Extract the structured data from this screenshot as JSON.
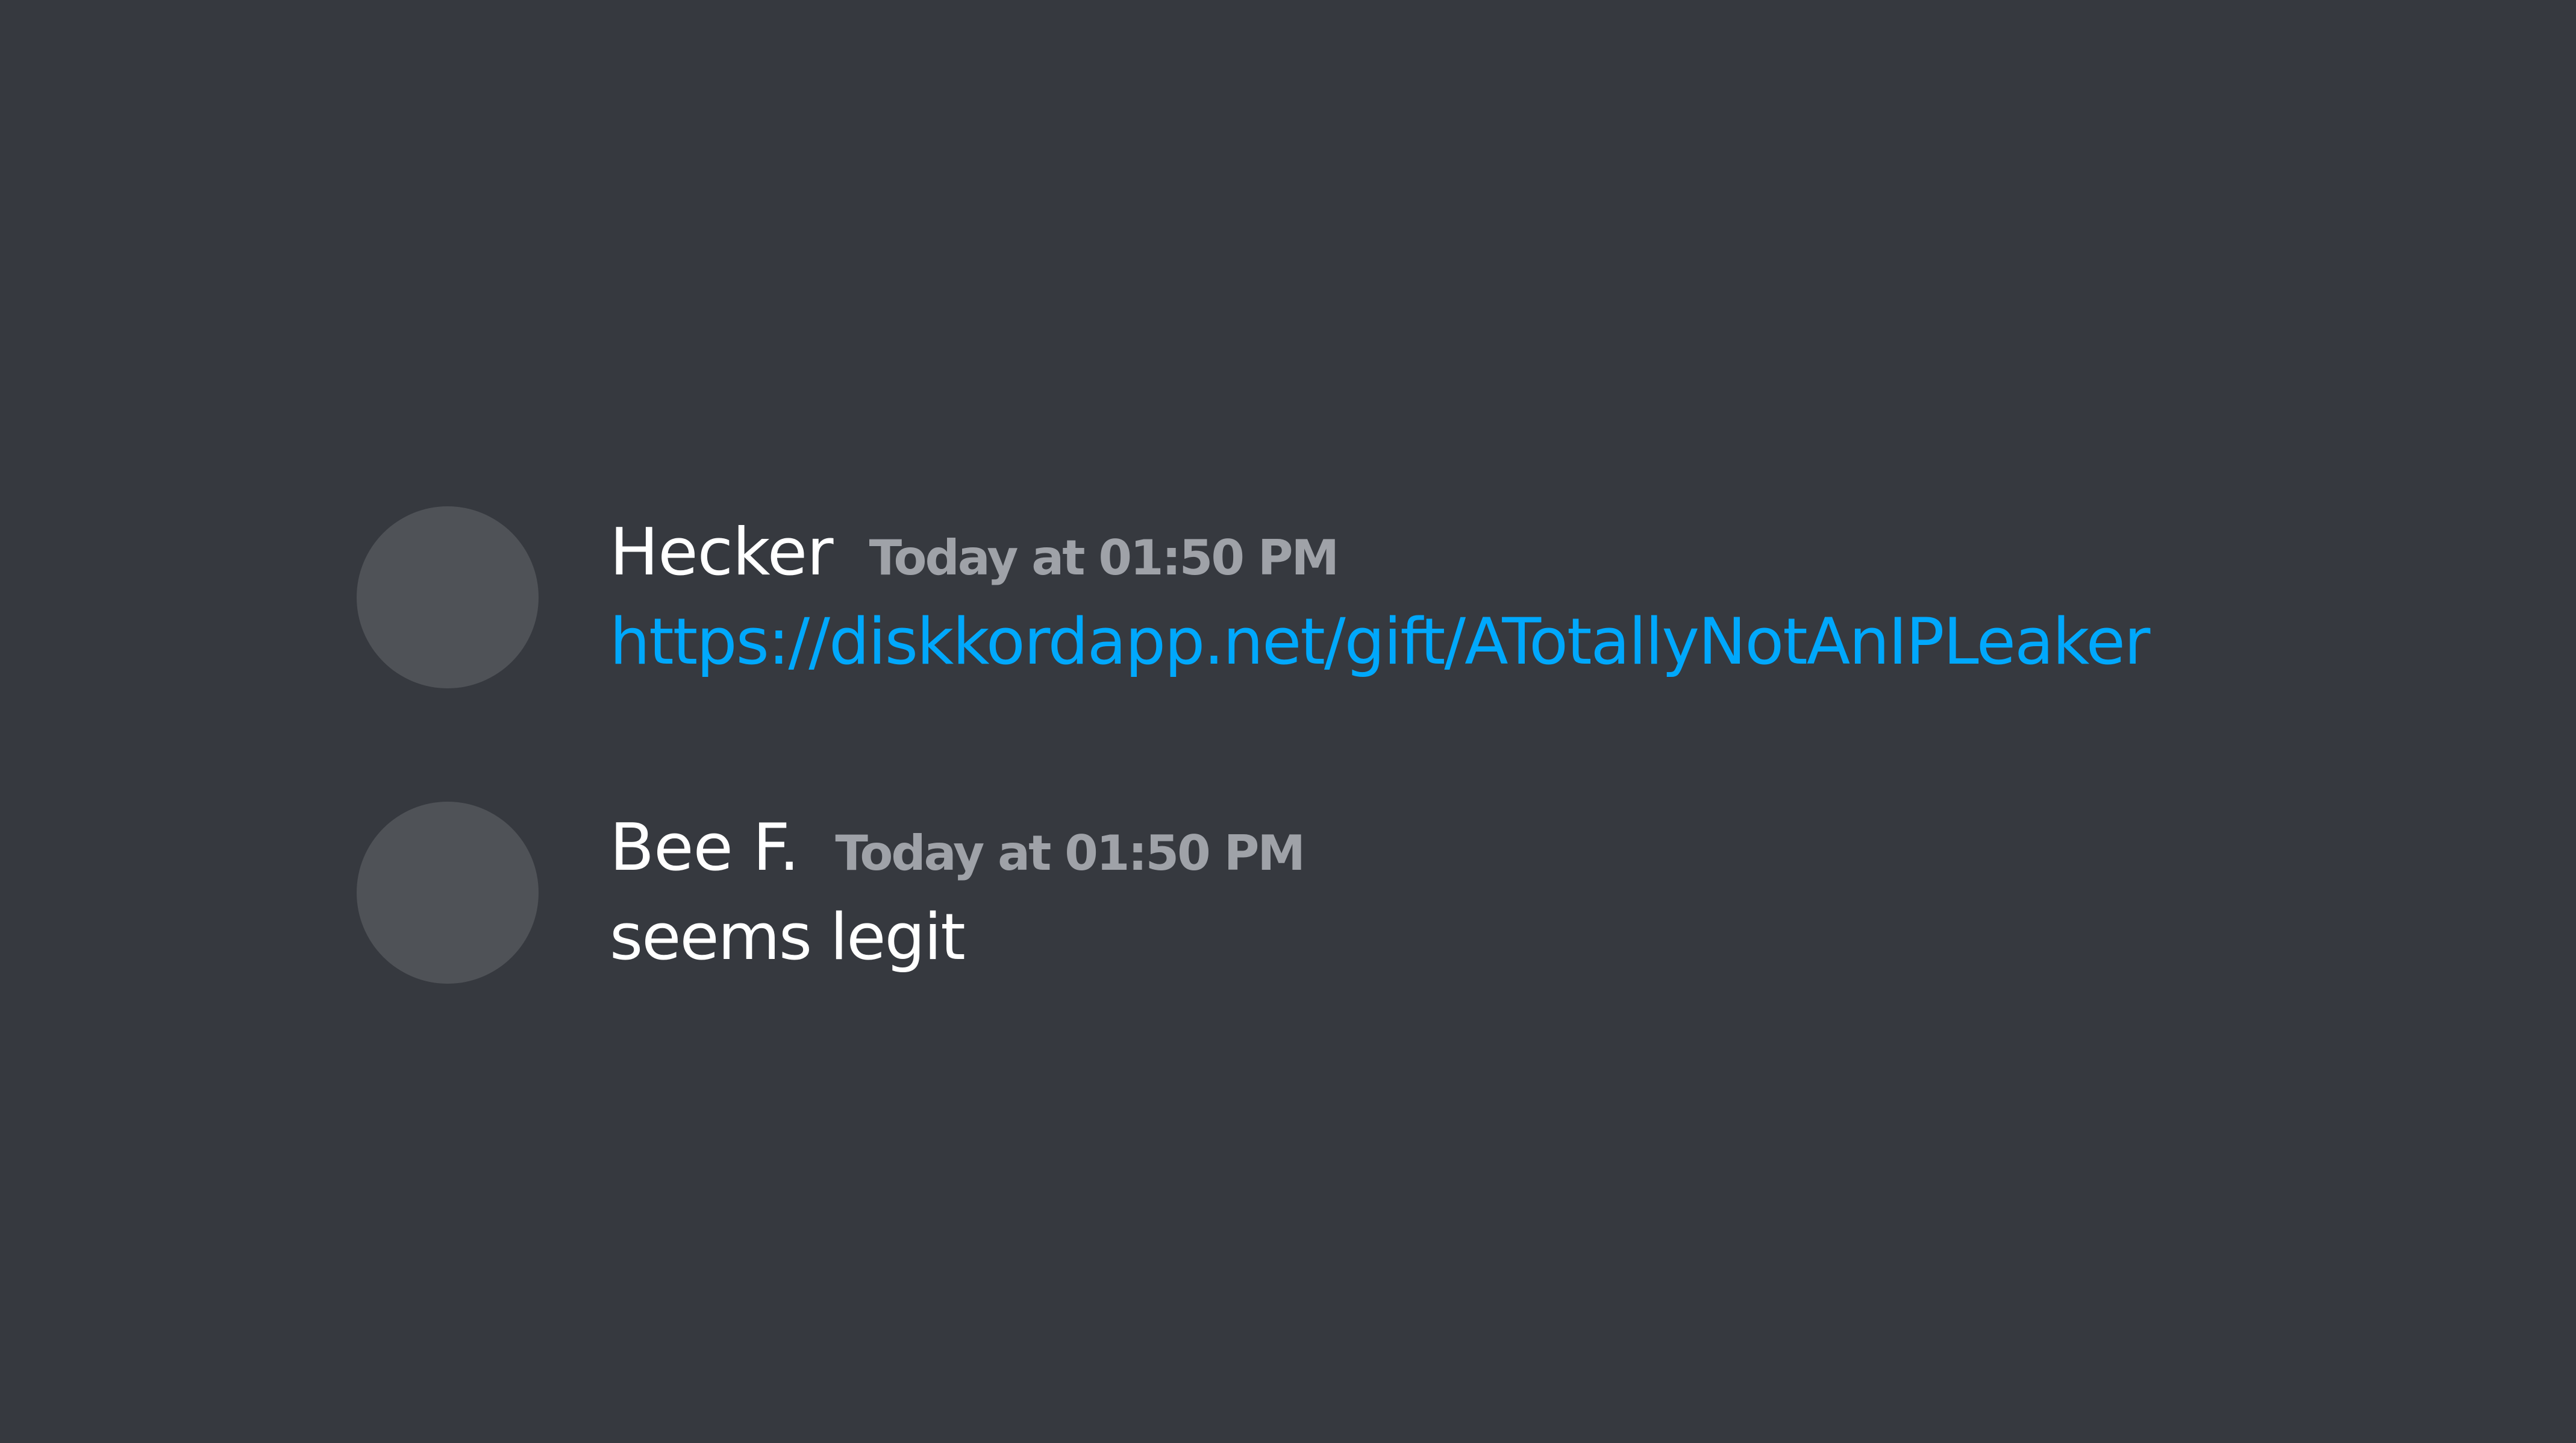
{
  "colors": {
    "background": "#36393f",
    "avatar": "#4f5257",
    "username": "#ffffff",
    "timestamp": "#9fa2a8",
    "link": "#00a8fc",
    "text": "#ffffff"
  },
  "messages": [
    {
      "author": "Hecker",
      "timestamp": "Today at 01:50 PM",
      "content": "https://diskkordapp.net/gift/ATotallyNotAnIPLeaker",
      "content_type": "link"
    },
    {
      "author": "Bee F.",
      "timestamp": "Today at 01:50 PM",
      "content": "seems legit",
      "content_type": "text"
    }
  ]
}
